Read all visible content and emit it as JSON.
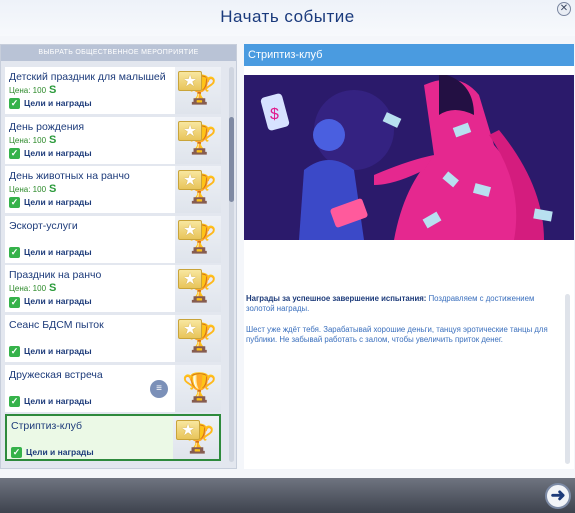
{
  "header": {
    "title": "Начать событие"
  },
  "left_panel": {
    "header_label": "ВЫБРАТЬ ОБЩЕСТВЕННОЕ МЕРОПРИЯТИЕ",
    "events": [
      {
        "name": "Детский праздник для малышей",
        "price": "Цена: 100",
        "goals": "Цели и награды",
        "badge": "star"
      },
      {
        "name": "День рождения",
        "price": "Цена: 100",
        "goals": "Цели и награды",
        "badge": "star"
      },
      {
        "name": "День животных на ранчо",
        "price": "Цена: 100",
        "goals": "Цели и награды",
        "badge": "star"
      },
      {
        "name": "Эскорт-услуги",
        "price": "",
        "goals": "Цели и награды",
        "badge": "star"
      },
      {
        "name": "Праздник на ранчо",
        "price": "Цена: 100",
        "goals": "Цели и награды",
        "badge": "star"
      },
      {
        "name": "Сеанс БДСМ пыток",
        "price": "",
        "goals": "Цели и награды",
        "badge": "star"
      },
      {
        "name": "Дружеская встреча",
        "price": "",
        "goals": "Цели и награды",
        "badge": "note"
      },
      {
        "name": "Стриптиз-клуб",
        "price": "",
        "goals": "Цели и награды",
        "badge": "star"
      }
    ],
    "currency_symbol": "S"
  },
  "detail": {
    "title": "Стриптиз-клуб",
    "reward_label": "Награды за успешное завершение испытания:",
    "reward_value": "Поздравляем с достижением золотой награды.",
    "description": "Шест уже ждёт тебя. Зарабатывай хорошие деньги, танцуя эротические танцы для публики. Не забывай работать с залом, чтобы увеличить приток денег."
  },
  "footer": {
    "next_icon": "arrow-right-icon"
  }
}
